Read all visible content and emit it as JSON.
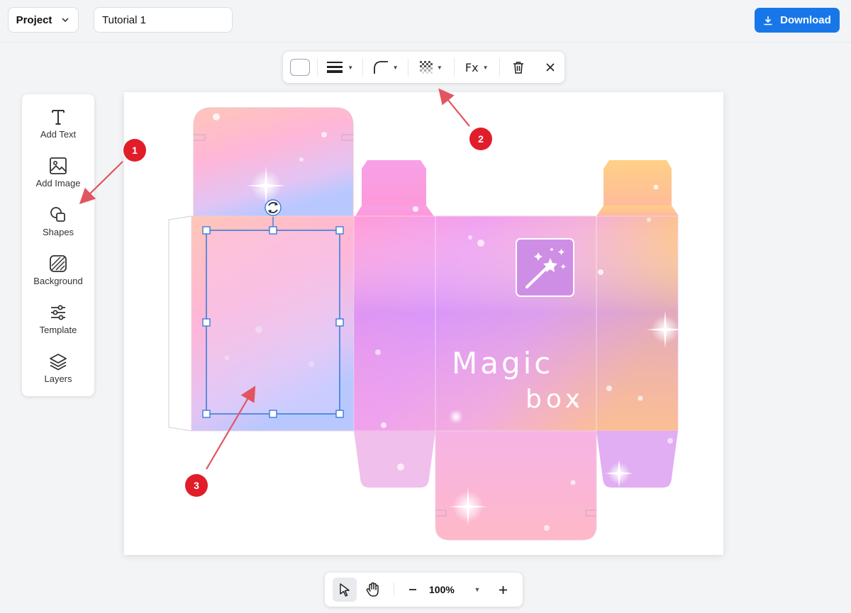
{
  "header": {
    "project_label": "Project",
    "title_value": "Tutorial 1",
    "download_label": "Download"
  },
  "toolbar": {
    "items": [
      "fill-color",
      "stroke-weight",
      "corner-radius",
      "opacity",
      "effects",
      "delete",
      "close"
    ],
    "fx_label": "Fx"
  },
  "sidebar": {
    "items": [
      {
        "label": "Add Text",
        "icon": "text-icon"
      },
      {
        "label": "Add Image",
        "icon": "image-icon"
      },
      {
        "label": "Shapes",
        "icon": "shapes-icon"
      },
      {
        "label": "Background",
        "icon": "background-icon"
      },
      {
        "label": "Template",
        "icon": "sliders-icon"
      },
      {
        "label": "Layers",
        "icon": "layers-icon"
      }
    ]
  },
  "canvas": {
    "design_text_1": "Magic",
    "design_text_2": "box",
    "logo_icon": "magic-wand-icon"
  },
  "zoom": {
    "value": "100%"
  },
  "callouts": [
    "1",
    "2",
    "3"
  ],
  "colors": {
    "accent": "#1877e8",
    "callout": "#e11d2a",
    "selection": "#3b7dd8"
  }
}
